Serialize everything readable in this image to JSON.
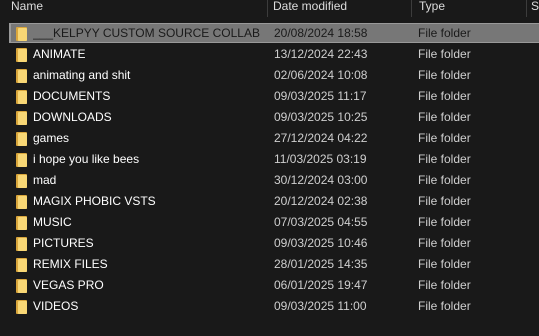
{
  "columns": {
    "name": "Name",
    "date": "Date modified",
    "type": "Type",
    "size": "S"
  },
  "selected_index": 0,
  "rows": [
    {
      "name": "___KELPYY CUSTOM SOURCE COLLAB",
      "date": "20/08/2024 18:58",
      "type": "File folder",
      "icon": "folder-icon"
    },
    {
      "name": "ANIMATE",
      "date": "13/12/2024 22:43",
      "type": "File folder",
      "icon": "folder-icon"
    },
    {
      "name": "animating and shit",
      "date": "02/06/2024 10:08",
      "type": "File folder",
      "icon": "folder-icon"
    },
    {
      "name": "DOCUMENTS",
      "date": "09/03/2025 11:17",
      "type": "File folder",
      "icon": "folder-icon"
    },
    {
      "name": "DOWNLOADS",
      "date": "09/03/2025 10:25",
      "type": "File folder",
      "icon": "folder-icon"
    },
    {
      "name": "games",
      "date": "27/12/2024 04:22",
      "type": "File folder",
      "icon": "folder-icon"
    },
    {
      "name": "i hope you like bees",
      "date": "11/03/2025 03:19",
      "type": "File folder",
      "icon": "folder-icon"
    },
    {
      "name": "mad",
      "date": "30/12/2024 03:00",
      "type": "File folder",
      "icon": "folder-icon"
    },
    {
      "name": "MAGIX PHOBIC VSTS",
      "date": "20/12/2024 02:38",
      "type": "File folder",
      "icon": "folder-icon"
    },
    {
      "name": "MUSIC",
      "date": "07/03/2025 04:55",
      "type": "File folder",
      "icon": "folder-icon"
    },
    {
      "name": "PICTURES",
      "date": "09/03/2025 10:46",
      "type": "File folder",
      "icon": "folder-icon"
    },
    {
      "name": "REMIX FILES",
      "date": "28/01/2025 14:35",
      "type": "File folder",
      "icon": "folder-icon"
    },
    {
      "name": "VEGAS PRO",
      "date": "06/01/2025 19:47",
      "type": "File folder",
      "icon": "folder-icon"
    },
    {
      "name": "VIDEOS",
      "date": "09/03/2025 11:00",
      "type": "File folder",
      "icon": "folder-icon"
    }
  ],
  "colors": {
    "background": "#191919",
    "selection": "#777777",
    "folder_front": "#f8d775",
    "folder_back": "#d9a63c"
  }
}
